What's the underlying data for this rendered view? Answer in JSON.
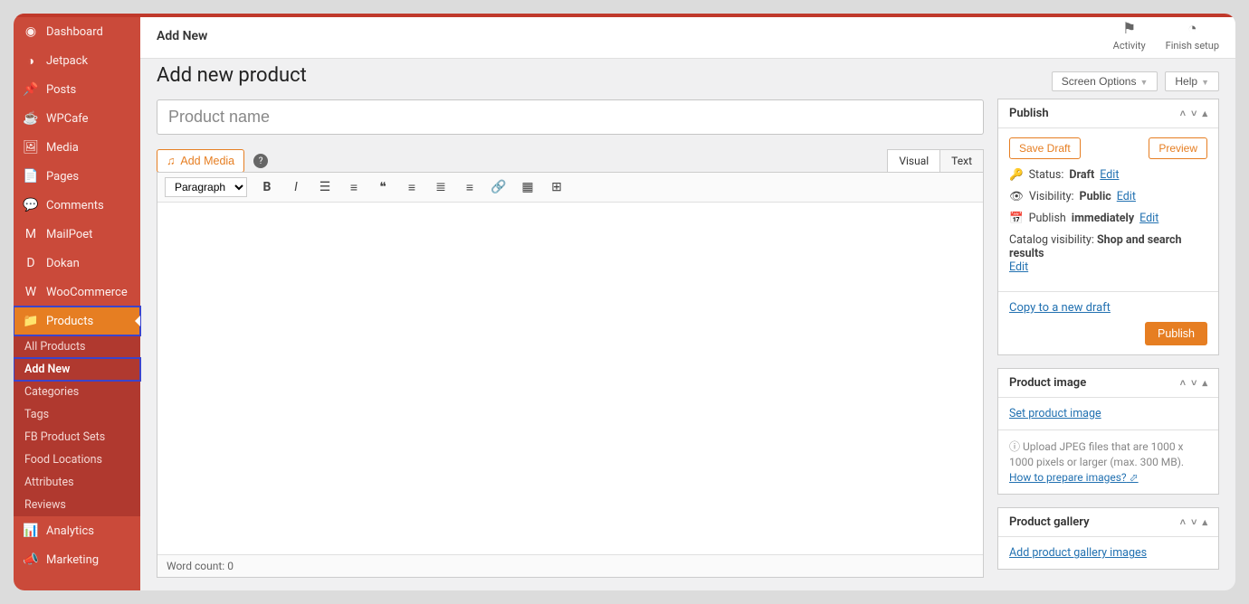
{
  "header": {
    "page": "Add New",
    "activity": "Activity",
    "finish_setup": "Finish setup"
  },
  "meta": {
    "screen_options": "Screen Options",
    "help": "Help"
  },
  "page_title": "Add new product",
  "title_placeholder": "Product name",
  "sidebar": {
    "items": [
      {
        "label": "Dashboard",
        "icon": "◉"
      },
      {
        "label": "Jetpack",
        "icon": "◑"
      },
      {
        "label": "Posts",
        "icon": "📌"
      },
      {
        "label": "WPCafe",
        "icon": "☕"
      },
      {
        "label": "Media",
        "icon": "🖼"
      },
      {
        "label": "Pages",
        "icon": "📄"
      },
      {
        "label": "Comments",
        "icon": "💬"
      },
      {
        "label": "MailPoet",
        "icon": "M"
      },
      {
        "label": "Dokan",
        "icon": "D"
      },
      {
        "label": "WooCommerce",
        "icon": "W"
      },
      {
        "label": "Products",
        "icon": "📁"
      },
      {
        "label": "Analytics",
        "icon": "📊"
      },
      {
        "label": "Marketing",
        "icon": "📣"
      }
    ],
    "sub": [
      "All Products",
      "Add New",
      "Categories",
      "Tags",
      "FB Product Sets",
      "Food Locations",
      "Attributes",
      "Reviews"
    ]
  },
  "editor": {
    "add_media": "Add Media",
    "tabs": {
      "visual": "Visual",
      "text": "Text"
    },
    "format_label": "Paragraph",
    "word_count_label": "Word count:",
    "word_count": "0"
  },
  "publish": {
    "title": "Publish",
    "save_draft": "Save Draft",
    "preview": "Preview",
    "status_label": "Status:",
    "status_value": "Draft",
    "visibility_label": "Visibility:",
    "visibility_value": "Public",
    "publish_label": "Publish",
    "publish_value": "immediately",
    "catalog_label": "Catalog visibility:",
    "catalog_value": "Shop and search results",
    "edit": "Edit",
    "copy_link": "Copy to a new draft",
    "publish_btn": "Publish"
  },
  "product_image": {
    "title": "Product image",
    "set_link": "Set product image",
    "info": "Upload JPEG files that are 1000 x 1000 pixels or larger (max. 300 MB).",
    "how_to": "How to prepare images?"
  },
  "product_gallery": {
    "title": "Product gallery",
    "add_link": "Add product gallery images"
  }
}
